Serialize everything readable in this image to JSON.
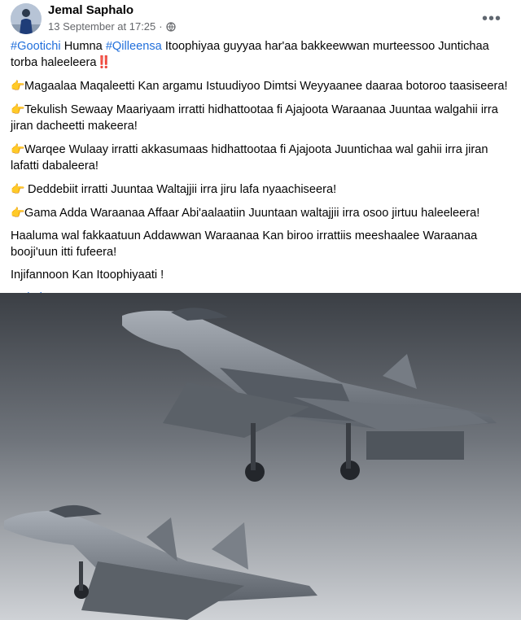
{
  "post": {
    "author": "Jemal Saphalo",
    "timestamp": "13 September at 17:25",
    "separator": "·",
    "more_icon": "more-horizontal-icon",
    "privacy_icon": "globe-icon"
  },
  "content": {
    "hashtag1": "#Gootichi",
    "word1": " Humna ",
    "hashtag2": "#Qilleensa",
    "headline_rest": " Itoophiyaa guyyaa har'aa bakkeewwan murteessoo Juntichaa torba haleeleera",
    "headline_emoji": "‼️",
    "hand_emoji": "👉",
    "bullets": [
      "Magaalaa Maqaleetti Kan argamu Istuudiyoo Dimtsi Weyyaanee daaraa botoroo taasiseera!",
      "Tekulish Sewaay Maariyaam irratti hidhattootaa fi Ajajoota Waraanaa Juuntaa walgahii irra jiran dacheetti makeera!",
      "Warqee Wulaay irratti akkasumaas hidhattootaa fi Ajajoota Juuntichaa wal gahii irra jiran lafatti dabaleera!",
      " Deddebiit irratti Juuntaa Waltajjii irra jiru lafa nyaachiseera!",
      "Gama Adda Waraanaa Affaar Abi'aalaatiin Juuntaan waltajjii irra osoo jirtuu haleeleera!"
    ],
    "closing1": "Haaluma wal fakkaatuun Addawwan Waraanaa Kan biroo irrattiis meeshaalee Waraanaa booji'uun itti fufeera!",
    "closing2": "Injifannoon Kan Itoophiyaati !",
    "signature": "#Mimi_Jarso"
  },
  "colors": {
    "link": "#216fdb",
    "meta": "#65676b",
    "sky_top": "#3c4046",
    "sky_bottom": "#c4c7cb",
    "jet": "#8a9099"
  }
}
